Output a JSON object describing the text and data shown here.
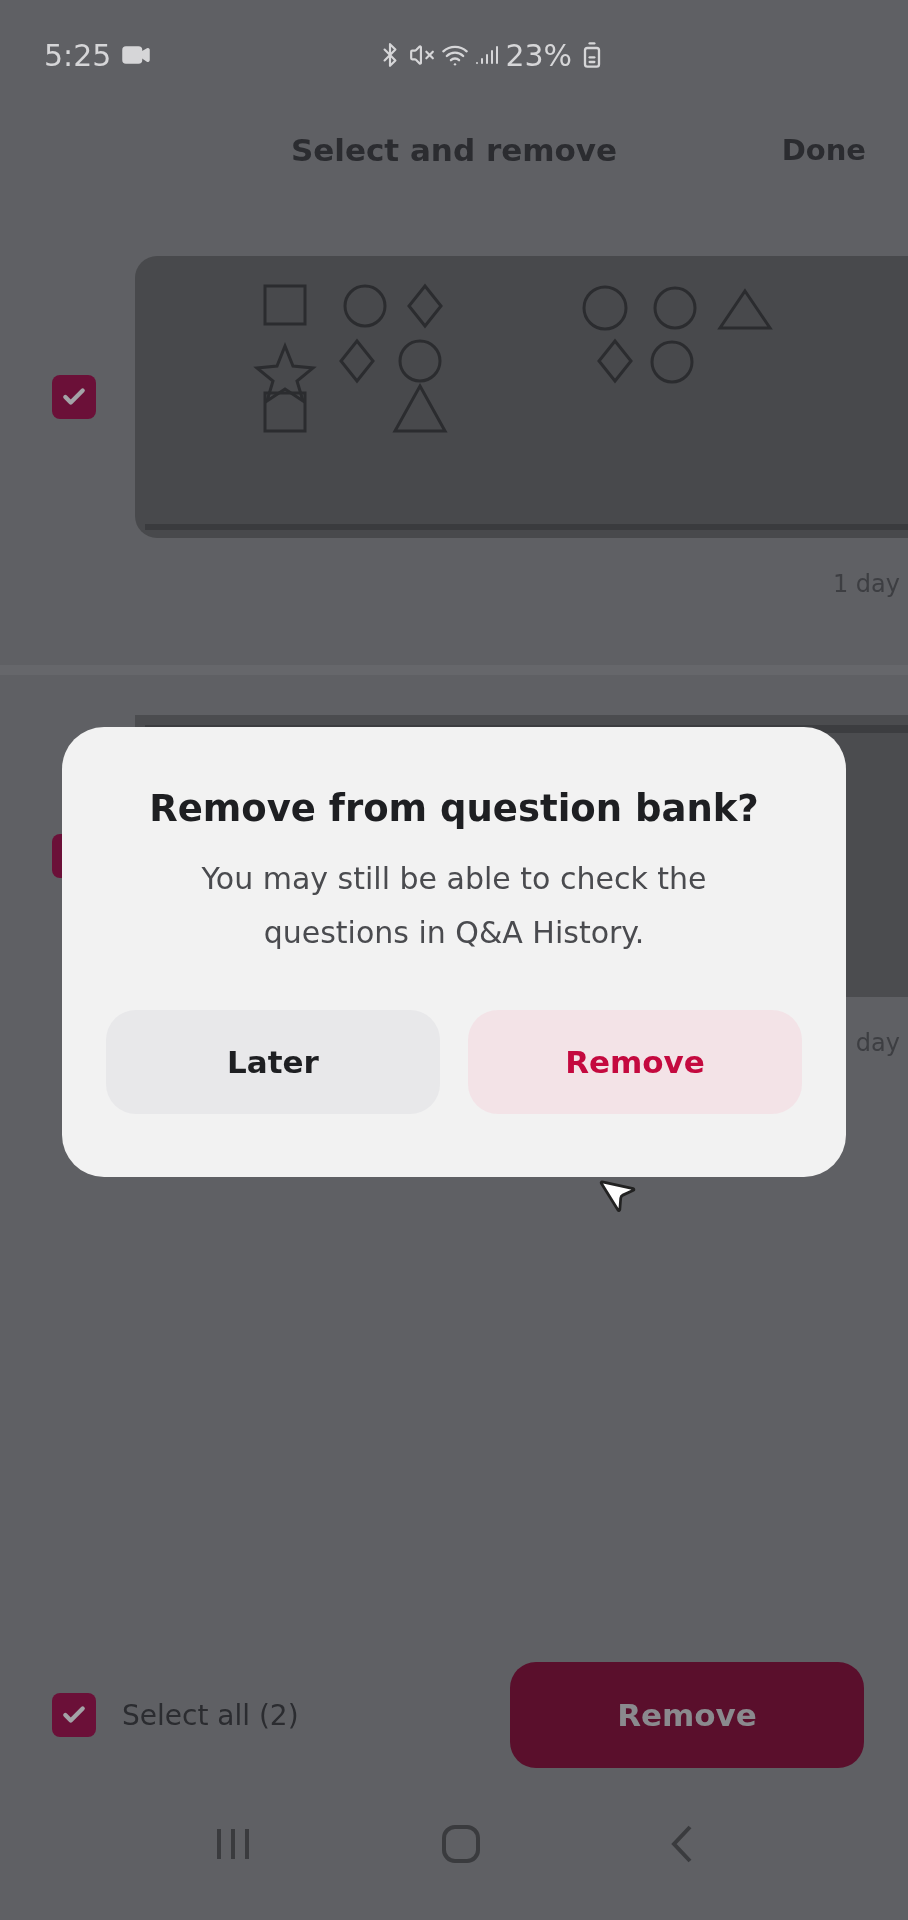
{
  "status_bar": {
    "time": "5:25",
    "battery": "23%"
  },
  "header": {
    "title": "Select and remove",
    "done": "Done"
  },
  "items": [
    {
      "checked": true,
      "age": "1 day",
      "kind": "picture"
    },
    {
      "checked": true,
      "age": "day",
      "kind": "picture"
    }
  ],
  "footer": {
    "select_all": {
      "label": "Select all (2)",
      "checked": true
    },
    "remove": "Remove"
  },
  "dialog": {
    "title": "Remove from question bank?",
    "message": "You may still be able to check the questions in Q&A History.",
    "buttons": [
      {
        "label": "Later",
        "kind": "secondary"
      },
      {
        "label": "Remove",
        "kind": "primary"
      }
    ]
  }
}
